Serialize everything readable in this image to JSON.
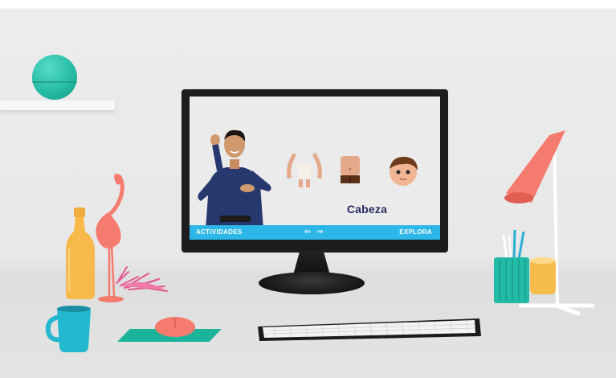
{
  "screen": {
    "topic_label": "Cabeza",
    "bottom_bar": {
      "left_label": "ACTIVIDADES",
      "nav_arrows": "⇐ ⇒",
      "brand": "EXPLORA"
    }
  },
  "colors": {
    "bar": "#2db6e8",
    "topic_text": "#2a2c62",
    "teal": "#26bca6",
    "coral": "#f4776a",
    "yellow": "#f6b94a"
  },
  "icons": [
    "arms-body-part-icon",
    "torso-body-part-icon",
    "head-body-part-icon",
    "back-arrow-icon",
    "forward-arrow-icon"
  ]
}
